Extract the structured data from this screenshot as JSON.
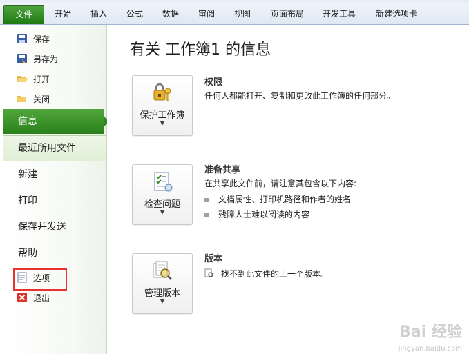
{
  "ribbon": {
    "file_tab": "文件",
    "tabs": [
      "开始",
      "插入",
      "公式",
      "数据",
      "审阅",
      "视图",
      "页面布局",
      "开发工具",
      "新建选项卡"
    ]
  },
  "nav": {
    "commands_top": [
      {
        "label": "保存",
        "icon": "save-icon"
      },
      {
        "label": "另存为",
        "icon": "save-as-icon"
      },
      {
        "label": "打开",
        "icon": "open-folder-icon"
      },
      {
        "label": "关闭",
        "icon": "close-folder-icon"
      }
    ],
    "tabs": [
      "信息",
      "最近所用文件",
      "新建",
      "打印",
      "保存并发送",
      "帮助"
    ],
    "selected_tab": "信息",
    "commands_bottom": [
      {
        "label": "选项",
        "icon": "options-icon"
      },
      {
        "label": "退出",
        "icon": "exit-icon"
      }
    ]
  },
  "main": {
    "title": "有关 工作簿1 的信息",
    "sections": [
      {
        "button_label": "保护工作簿",
        "button_icon": "key-lock-icon",
        "title": "权限",
        "description": "任何人都能打开、复制和更改此工作簿的任何部分。",
        "bullets": []
      },
      {
        "button_label": "检查问题",
        "button_icon": "checklist-icon",
        "title": "准备共享",
        "description": "在共享此文件前，请注意其包含以下内容:",
        "bullets": [
          "文档属性、打印机路径和作者的姓名",
          "残障人士难以阅读的内容"
        ]
      },
      {
        "button_label": "管理版本",
        "button_icon": "version-search-icon",
        "title": "版本",
        "description": "找不到此文件的上一个版本。",
        "bullets": []
      }
    ]
  },
  "colors": {
    "accent_green": "#2a8119",
    "highlight_red": "#e8322e"
  },
  "watermark": {
    "logo": "Bai 经验",
    "url": "jingyan.baidu.com"
  }
}
